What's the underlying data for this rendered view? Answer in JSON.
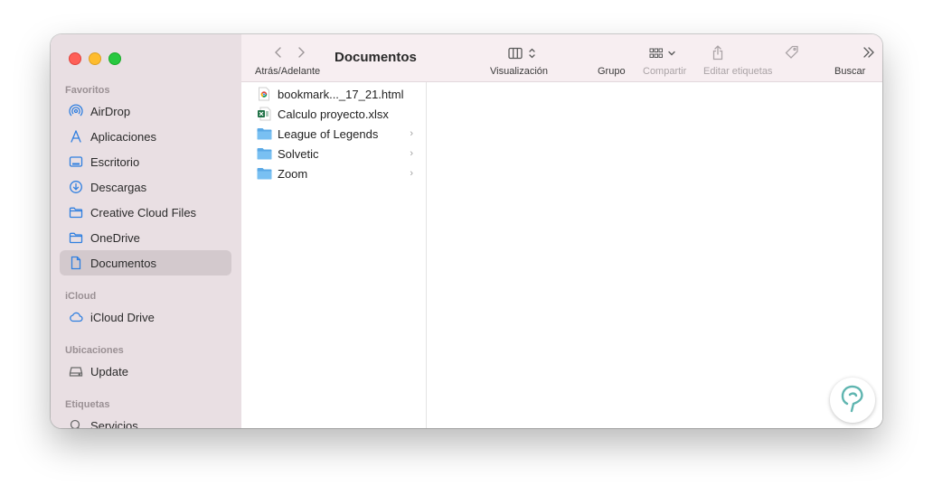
{
  "sidebar": {
    "sections": {
      "favoritos": "Favoritos",
      "icloud": "iCloud",
      "ubicaciones": "Ubicaciones",
      "etiquetas": "Etiquetas"
    },
    "items": [
      {
        "label": "AirDrop",
        "icon": "airdrop-icon"
      },
      {
        "label": "Aplicaciones",
        "icon": "applications-icon"
      },
      {
        "label": "Escritorio",
        "icon": "desktop-icon"
      },
      {
        "label": "Descargas",
        "icon": "downloads-icon"
      },
      {
        "label": "Creative Cloud Files",
        "icon": "folder-icon"
      },
      {
        "label": "OneDrive",
        "icon": "folder-icon"
      },
      {
        "label": "Documentos",
        "icon": "document-icon",
        "active": true
      },
      {
        "label": "iCloud Drive",
        "icon": "cloud-icon"
      },
      {
        "label": "Update",
        "icon": "drive-icon"
      },
      {
        "label": "Servicios",
        "icon": "search-icon"
      }
    ]
  },
  "toolbar": {
    "title": "Documentos",
    "nav_label": "Atrás/Adelante",
    "view_label": "Visualización",
    "group_label": "Grupo",
    "share_label": "Compartir",
    "tags_label": "Editar etiquetas",
    "search_label": "Buscar"
  },
  "files": [
    {
      "name": "bookmark..._17_21.html",
      "icon": "chrome-html-icon",
      "folder": false
    },
    {
      "name": "Calculo proyecto.xlsx",
      "icon": "excel-icon",
      "folder": false
    },
    {
      "name": "League of Legends",
      "icon": "folder-icon",
      "folder": true
    },
    {
      "name": "Solvetic",
      "icon": "folder-icon",
      "folder": true
    },
    {
      "name": "Zoom",
      "icon": "folder-icon",
      "folder": true
    }
  ],
  "colors": {
    "accent": "#2f7fe0",
    "sidebar_bg": "#e9dfe3",
    "toolbar_bg": "#f7eef1",
    "folder_blue": "#6cb6ec"
  }
}
